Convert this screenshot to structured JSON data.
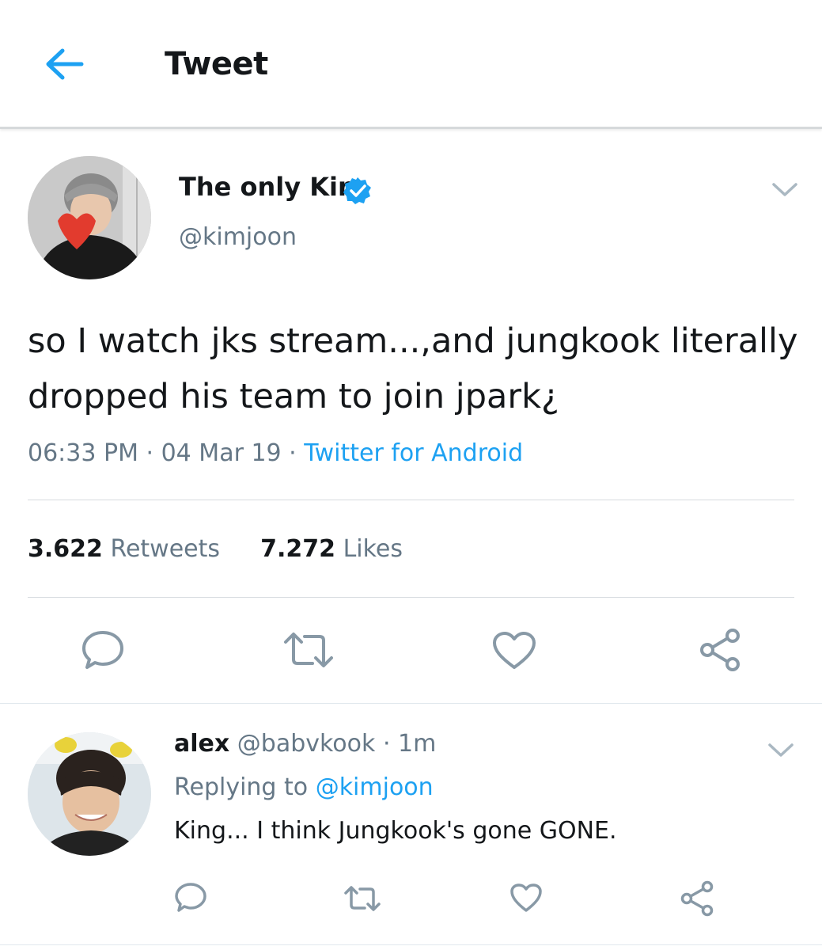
{
  "header": {
    "title": "Tweet",
    "back_icon": "arrow-left-icon",
    "accent": "#1da1f2"
  },
  "tweet": {
    "display_name": "The only Kim",
    "handle": "@kimjoon",
    "verified": true,
    "text": "so I watch jks stream...,and jungkook literally dropped his team to join jpark¿",
    "time": "06:33 PM",
    "date": "04 Mar 19",
    "source": "Twitter for Android",
    "retweets_count": "3.622",
    "retweets_label": "Retweets",
    "likes_count": "7.272",
    "likes_label": "Likes"
  },
  "reply": {
    "display_name": "alex",
    "handle": "@babvkook",
    "age": "1m",
    "replying_prefix": "Replying to",
    "replying_to": "@kimjoon",
    "text": "King... I think Jungkook's gone GONE."
  },
  "colors": {
    "link": "#1da1f2",
    "muted": "#657786",
    "text": "#14171a",
    "icon": "#8899a6"
  }
}
